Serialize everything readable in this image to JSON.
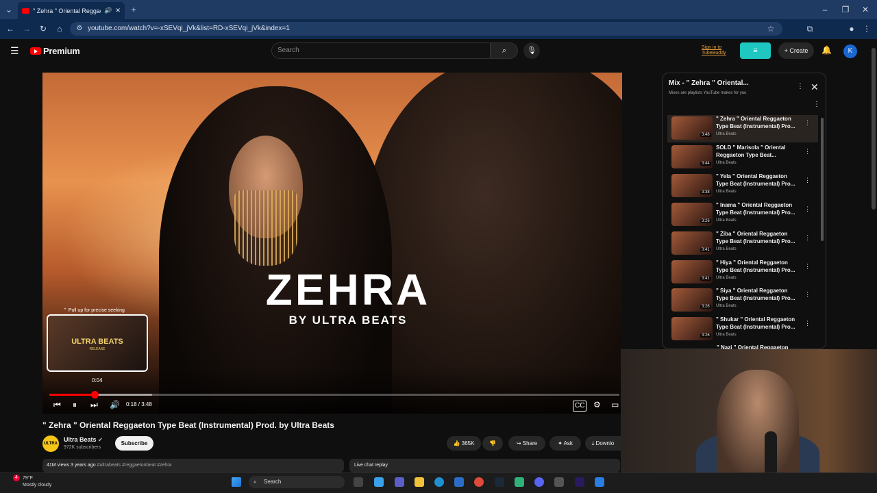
{
  "browser": {
    "tab_title": "\" Zehra \" Oriental Reggaeto",
    "url": "youtube.com/watch?v=-xSEVqi_jVk&list=RD-xSEVqi_jVk&index=1"
  },
  "header": {
    "logo_text": "Premium",
    "search_placeholder": "Search",
    "tubebuddy_link": "Sign in to TubeBuddy",
    "create_label": "Create",
    "avatar_letter": "K"
  },
  "video": {
    "overlay_title": "ZEHRA",
    "overlay_subtitle": "BY ULTRA BEATS",
    "seek_hint": "Pull up for precise seeking",
    "preview_text": "ULTRA BEATS",
    "preview_subtext": "RELEASE",
    "preview_time": "0:04",
    "time_display": "0:18 / 3:48",
    "progress_played": 0.079,
    "progress_buffered": 0.18
  },
  "details": {
    "title": "\" Zehra \" Oriental Reggaeton Type Beat (Instrumental) Prod. by Ultra Beats",
    "channel_avatar_text": "ULTRA",
    "channel_name": "Ultra Beats",
    "subscribers": "972K subscribers",
    "subscribe_label": "Subscribe",
    "likes": "365K",
    "share_label": "Share",
    "ask_label": "Ask",
    "download_label": "Downlo",
    "views_date": "41M views  3 years ago",
    "hashtags": "#ultrabeats #reggaetonbeat #zehra",
    "live_chat": "Live chat replay"
  },
  "playlist": {
    "title": "Mix - \" Zehra \" Oriental...",
    "subtitle": "Mixes are playlists YouTube makes for you",
    "items": [
      {
        "title": "\" Zehra \" Oriental Reggaeton Type Beat (Instrumental) Pro...",
        "channel": "Ultra Beats",
        "duration": "3:48"
      },
      {
        "title": "SOLD \" Marisola \" Oriental Reggaeton Type Beat...",
        "channel": "Ultra Beats",
        "duration": "3:44"
      },
      {
        "title": "\" Yela \" Oriental Reggaeton Type Beat (Instrumental) Pro...",
        "channel": "Ultra Beats",
        "duration": "3:38"
      },
      {
        "title": "\" Inama \" Oriental Reggaeton Type Beat (Instrumental) Pro...",
        "channel": "Ultra Beats",
        "duration": "3:26"
      },
      {
        "title": "\" Ziba \" Oriental Reggaeton Type Beat (Instrumental) Pro...",
        "channel": "Ultra Beats",
        "duration": "3:41"
      },
      {
        "title": "\" Hiya \" Oriental Reggaeton Type Beat (Instrumental) Pro...",
        "channel": "Ultra Beats",
        "duration": "3:41"
      },
      {
        "title": "\" Siya \" Oriental Reggaeton Type Beat (Instrumental) Pro...",
        "channel": "Ultra Beats",
        "duration": "3:26"
      },
      {
        "title": "\" Shukar \" Oriental Reggaeton Type Beat (Instrumental) Pro...",
        "channel": "Ultra Beats",
        "duration": "3:26"
      }
    ],
    "partial_item": "\" Nazi \" Oriental Reggaeton"
  },
  "taskbar": {
    "weather_temp": "79°F",
    "weather_desc": "Mostly cloudy",
    "weather_badge": "4",
    "search_label": "Search"
  },
  "colors": {
    "brand_red": "#ff0000",
    "tubebuddy": "#1ec7c0",
    "background": "#0f0f0f"
  },
  "icons": [
    "menu-icon",
    "search-icon",
    "mic-icon",
    "bell-icon",
    "play-icon",
    "pause-icon",
    "next-icon",
    "volume-icon",
    "settings-icon",
    "captions-icon",
    "like-icon",
    "dislike-icon",
    "share-icon",
    "download-icon",
    "close-icon",
    "more-icon"
  ]
}
